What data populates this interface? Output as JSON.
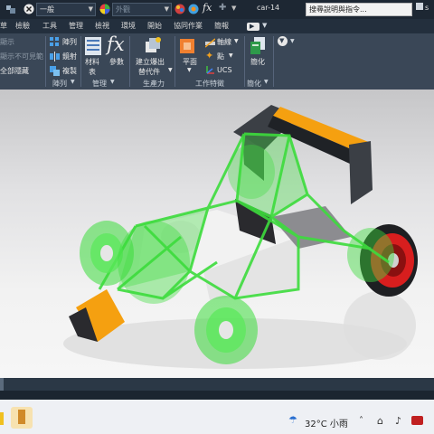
{
  "qat": {
    "style_combo": "一般",
    "material_combo": "外觀",
    "fx_label": "fx",
    "doc_title": "car-14",
    "search_placeholder": "搜尋說明與指令...",
    "user_initial": "s"
  },
  "tabs": [
    {
      "label": "草"
    },
    {
      "label": "檢驗"
    },
    {
      "label": "工具"
    },
    {
      "label": "管理"
    },
    {
      "label": "檢視"
    },
    {
      "label": "環境"
    },
    {
      "label": "開始"
    },
    {
      "label": "協同作業"
    },
    {
      "label": "簡報"
    }
  ],
  "ribbon": {
    "visibility": {
      "show": "顯示",
      "show_not_first": "顯示不可見範",
      "hide_all": "全部隱藏"
    },
    "pattern": {
      "array": "陣列",
      "mirror": "鏡射",
      "copy": "複製",
      "title": "陣列"
    },
    "manage": {
      "materials": "材料",
      "materials2": "表",
      "parameters": "參數",
      "fx_glyph": "fx",
      "title": "管理"
    },
    "productivity": {
      "create": "建立爆出",
      "replace": "替代件",
      "title": "生產力"
    },
    "work_features": {
      "plane": "平面",
      "axis": "軸線",
      "point": "點",
      "ucs": "UCS",
      "title": "工作特徵"
    },
    "simplify": {
      "simplify": "簡化",
      "title": "簡化"
    }
  },
  "taskbar": {
    "temperature": "32°C",
    "condition": "小雨"
  },
  "colors": {
    "frame_green": "#3ddc3d",
    "nose_orange": "#f5a010",
    "wing_dark": "#3b3f45",
    "wheel_red": "#d81e1e",
    "ribbon_bg": "#3a4757",
    "tab_bg": "#232f3d"
  }
}
